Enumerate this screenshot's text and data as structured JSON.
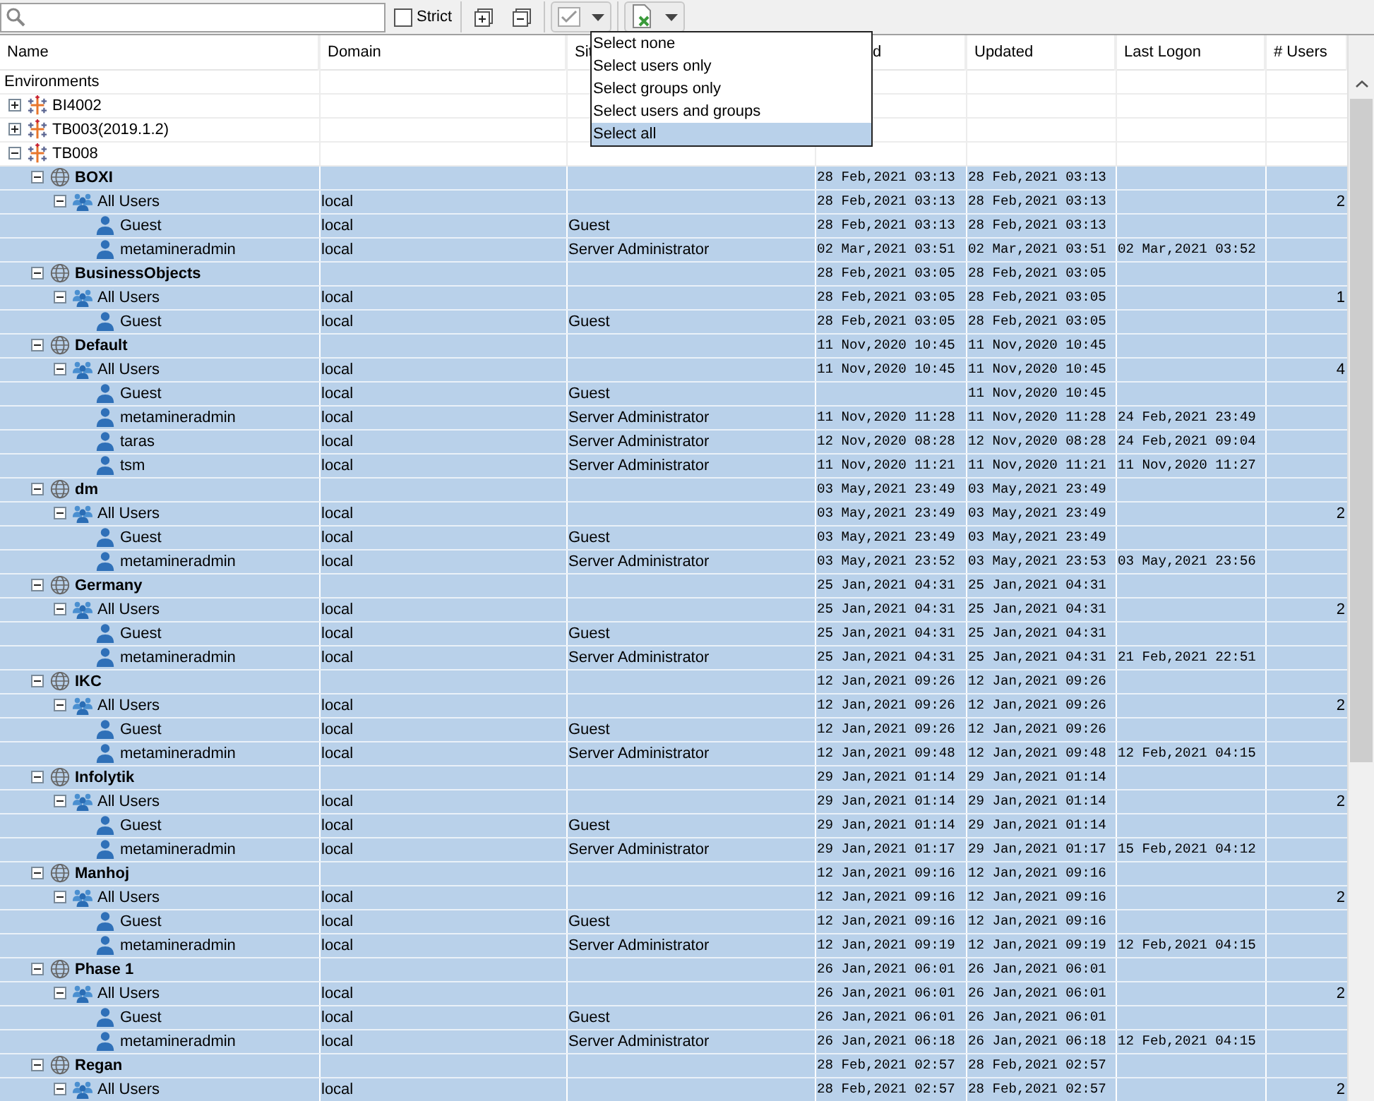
{
  "toolbar": {
    "strict": {
      "label": "Strict",
      "checked": false
    }
  },
  "select_menu": {
    "items": [
      {
        "label": "Select none",
        "selected": false
      },
      {
        "label": "Select users only",
        "selected": false
      },
      {
        "label": "Select groups only",
        "selected": false
      },
      {
        "label": "Select users and groups",
        "selected": false
      },
      {
        "label": "Select all",
        "selected": true
      }
    ]
  },
  "table": {
    "columns": [
      "Name",
      "Domain",
      "Sit",
      "d",
      "Updated",
      "Last Logon",
      "# Users"
    ],
    "rows": [
      {
        "kind": "label",
        "name": "Environments",
        "selected": false
      },
      {
        "kind": "environment",
        "name": "BI4002",
        "expanded": false,
        "selected": false
      },
      {
        "kind": "environment",
        "name": "TB003(2019.1.2)",
        "expanded": false,
        "selected": false
      },
      {
        "kind": "environment",
        "name": "TB008",
        "expanded": true,
        "selected": false,
        "children": [
          {
            "kind": "site",
            "name": "BOXI",
            "column_4": "28 Feb,2021 03:13",
            "updated": "28 Feb,2021 03:13",
            "expanded": true,
            "selected": true,
            "children": [
              {
                "kind": "group",
                "name": "All Users",
                "domain": "local",
                "column_4": "28 Feb,2021 03:13",
                "updated": "28 Feb,2021 03:13",
                "users": "2",
                "expanded": true,
                "selected": true,
                "children": [
                  {
                    "kind": "user",
                    "name": "Guest",
                    "domain": "local",
                    "column_3": "Guest",
                    "column_4": "28 Feb,2021 03:13",
                    "updated": "28 Feb,2021 03:13",
                    "selected": true
                  },
                  {
                    "kind": "user",
                    "name": "metamineradmin",
                    "domain": "local",
                    "column_3": "Server Administrator",
                    "column_4": "02 Mar,2021 03:51",
                    "updated": "02 Mar,2021 03:51",
                    "last_logon": "02 Mar,2021 03:52",
                    "selected": true
                  }
                ]
              }
            ]
          },
          {
            "kind": "site",
            "name": "BusinessObjects",
            "column_4": "28 Feb,2021 03:05",
            "updated": "28 Feb,2021 03:05",
            "expanded": true,
            "selected": true,
            "children": [
              {
                "kind": "group",
                "name": "All Users",
                "domain": "local",
                "column_4": "28 Feb,2021 03:05",
                "updated": "28 Feb,2021 03:05",
                "users": "1",
                "expanded": true,
                "selected": true,
                "children": [
                  {
                    "kind": "user",
                    "name": "Guest",
                    "domain": "local",
                    "column_3": "Guest",
                    "column_4": "28 Feb,2021 03:05",
                    "updated": "28 Feb,2021 03:05",
                    "selected": true
                  }
                ]
              }
            ]
          },
          {
            "kind": "site",
            "name": "Default",
            "column_4": "11 Nov,2020 10:45",
            "updated": "11 Nov,2020 10:45",
            "expanded": true,
            "selected": true,
            "children": [
              {
                "kind": "group",
                "name": "All Users",
                "domain": "local",
                "column_4": "11 Nov,2020 10:45",
                "updated": "11 Nov,2020 10:45",
                "users": "4",
                "expanded": true,
                "selected": true,
                "children": [
                  {
                    "kind": "user",
                    "name": "Guest",
                    "domain": "local",
                    "column_3": "Guest",
                    "updated": "11 Nov,2020 10:45",
                    "selected": true
                  },
                  {
                    "kind": "user",
                    "name": "metamineradmin",
                    "domain": "local",
                    "column_3": "Server Administrator",
                    "column_4": "11 Nov,2020 11:28",
                    "updated": "11 Nov,2020 11:28",
                    "last_logon": "24 Feb,2021 23:49",
                    "selected": true
                  },
                  {
                    "kind": "user",
                    "name": "taras",
                    "domain": "local",
                    "column_3": "Server Administrator",
                    "column_4": "12 Nov,2020 08:28",
                    "updated": "12 Nov,2020 08:28",
                    "last_logon": "24 Feb,2021 09:04",
                    "selected": true
                  },
                  {
                    "kind": "user",
                    "name": "tsm",
                    "domain": "local",
                    "column_3": "Server Administrator",
                    "column_4": "11 Nov,2020 11:21",
                    "updated": "11 Nov,2020 11:21",
                    "last_logon": "11 Nov,2020 11:27",
                    "selected": true
                  }
                ]
              }
            ]
          },
          {
            "kind": "site",
            "name": "dm",
            "column_4": "03 May,2021 23:49",
            "updated": "03 May,2021 23:49",
            "expanded": true,
            "selected": true,
            "children": [
              {
                "kind": "group",
                "name": "All Users",
                "domain": "local",
                "column_4": "03 May,2021 23:49",
                "updated": "03 May,2021 23:49",
                "users": "2",
                "expanded": true,
                "selected": true,
                "children": [
                  {
                    "kind": "user",
                    "name": "Guest",
                    "domain": "local",
                    "column_3": "Guest",
                    "column_4": "03 May,2021 23:49",
                    "updated": "03 May,2021 23:49",
                    "selected": true
                  },
                  {
                    "kind": "user",
                    "name": "metamineradmin",
                    "domain": "local",
                    "column_3": "Server Administrator",
                    "column_4": "03 May,2021 23:52",
                    "updated": "03 May,2021 23:53",
                    "last_logon": "03 May,2021 23:56",
                    "selected": true
                  }
                ]
              }
            ]
          },
          {
            "kind": "site",
            "name": "Germany",
            "column_4": "25 Jan,2021 04:31",
            "updated": "25 Jan,2021 04:31",
            "expanded": true,
            "selected": true,
            "children": [
              {
                "kind": "group",
                "name": "All Users",
                "domain": "local",
                "column_4": "25 Jan,2021 04:31",
                "updated": "25 Jan,2021 04:31",
                "users": "2",
                "expanded": true,
                "selected": true,
                "children": [
                  {
                    "kind": "user",
                    "name": "Guest",
                    "domain": "local",
                    "column_3": "Guest",
                    "column_4": "25 Jan,2021 04:31",
                    "updated": "25 Jan,2021 04:31",
                    "selected": true
                  },
                  {
                    "kind": "user",
                    "name": "metamineradmin",
                    "domain": "local",
                    "column_3": "Server Administrator",
                    "column_4": "25 Jan,2021 04:31",
                    "updated": "25 Jan,2021 04:31",
                    "last_logon": "21 Feb,2021 22:51",
                    "selected": true
                  }
                ]
              }
            ]
          },
          {
            "kind": "site",
            "name": "IKC",
            "column_4": "12 Jan,2021 09:26",
            "updated": "12 Jan,2021 09:26",
            "expanded": true,
            "selected": true,
            "children": [
              {
                "kind": "group",
                "name": "All Users",
                "domain": "local",
                "column_4": "12 Jan,2021 09:26",
                "updated": "12 Jan,2021 09:26",
                "users": "2",
                "expanded": true,
                "selected": true,
                "children": [
                  {
                    "kind": "user",
                    "name": "Guest",
                    "domain": "local",
                    "column_3": "Guest",
                    "column_4": "12 Jan,2021 09:26",
                    "updated": "12 Jan,2021 09:26",
                    "selected": true
                  },
                  {
                    "kind": "user",
                    "name": "metamineradmin",
                    "domain": "local",
                    "column_3": "Server Administrator",
                    "column_4": "12 Jan,2021 09:48",
                    "updated": "12 Jan,2021 09:48",
                    "last_logon": "12 Feb,2021 04:15",
                    "selected": true
                  }
                ]
              }
            ]
          },
          {
            "kind": "site",
            "name": "Infolytik",
            "column_4": "29 Jan,2021 01:14",
            "updated": "29 Jan,2021 01:14",
            "expanded": true,
            "selected": true,
            "children": [
              {
                "kind": "group",
                "name": "All Users",
                "domain": "local",
                "column_4": "29 Jan,2021 01:14",
                "updated": "29 Jan,2021 01:14",
                "users": "2",
                "expanded": true,
                "selected": true,
                "children": [
                  {
                    "kind": "user",
                    "name": "Guest",
                    "domain": "local",
                    "column_3": "Guest",
                    "column_4": "29 Jan,2021 01:14",
                    "updated": "29 Jan,2021 01:14",
                    "selected": true
                  },
                  {
                    "kind": "user",
                    "name": "metamineradmin",
                    "domain": "local",
                    "column_3": "Server Administrator",
                    "column_4": "29 Jan,2021 01:17",
                    "updated": "29 Jan,2021 01:17",
                    "last_logon": "15 Feb,2021 04:12",
                    "selected": true
                  }
                ]
              }
            ]
          },
          {
            "kind": "site",
            "name": "Manhoj",
            "column_4": "12 Jan,2021 09:16",
            "updated": "12 Jan,2021 09:16",
            "expanded": true,
            "selected": true,
            "children": [
              {
                "kind": "group",
                "name": "All Users",
                "domain": "local",
                "column_4": "12 Jan,2021 09:16",
                "updated": "12 Jan,2021 09:16",
                "users": "2",
                "expanded": true,
                "selected": true,
                "children": [
                  {
                    "kind": "user",
                    "name": "Guest",
                    "domain": "local",
                    "column_3": "Guest",
                    "column_4": "12 Jan,2021 09:16",
                    "updated": "12 Jan,2021 09:16",
                    "selected": true
                  },
                  {
                    "kind": "user",
                    "name": "metamineradmin",
                    "domain": "local",
                    "column_3": "Server Administrator",
                    "column_4": "12 Jan,2021 09:19",
                    "updated": "12 Jan,2021 09:19",
                    "last_logon": "12 Feb,2021 04:15",
                    "selected": true
                  }
                ]
              }
            ]
          },
          {
            "kind": "site",
            "name": "Phase 1",
            "column_4": "26 Jan,2021 06:01",
            "updated": "26 Jan,2021 06:01",
            "expanded": true,
            "selected": true,
            "children": [
              {
                "kind": "group",
                "name": "All Users",
                "domain": "local",
                "column_4": "26 Jan,2021 06:01",
                "updated": "26 Jan,2021 06:01",
                "users": "2",
                "expanded": true,
                "selected": true,
                "children": [
                  {
                    "kind": "user",
                    "name": "Guest",
                    "domain": "local",
                    "column_3": "Guest",
                    "column_4": "26 Jan,2021 06:01",
                    "updated": "26 Jan,2021 06:01",
                    "selected": true
                  },
                  {
                    "kind": "user",
                    "name": "metamineradmin",
                    "domain": "local",
                    "column_3": "Server Administrator",
                    "column_4": "26 Jan,2021 06:18",
                    "updated": "26 Jan,2021 06:18",
                    "last_logon": "12 Feb,2021 04:15",
                    "selected": true
                  }
                ]
              }
            ]
          },
          {
            "kind": "site",
            "name": "Regan",
            "column_4": "28 Feb,2021 02:57",
            "updated": "28 Feb,2021 02:57",
            "expanded": true,
            "selected": true,
            "children": [
              {
                "kind": "group",
                "name": "All Users",
                "domain": "local",
                "column_4": "28 Feb,2021 02:57",
                "updated": "28 Feb,2021 02:57",
                "users": "2",
                "expanded": true,
                "selected": true
              }
            ]
          }
        ]
      }
    ]
  }
}
